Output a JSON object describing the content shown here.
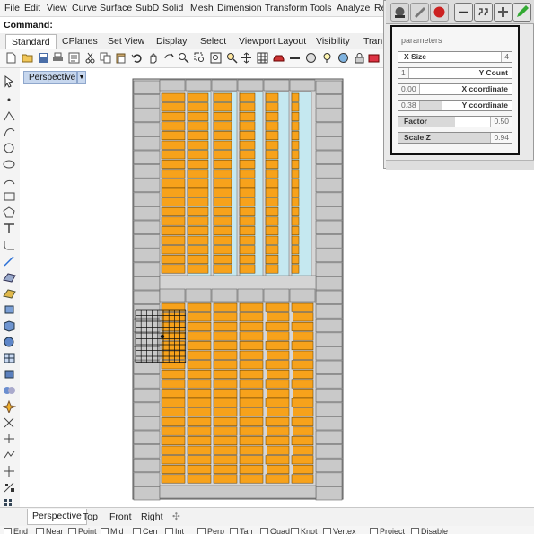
{
  "menu": [
    "File",
    "Edit",
    "View",
    "Curve",
    "Surface",
    "SubD",
    "Solid",
    "Mesh",
    "Dimension",
    "Transform",
    "Tools",
    "Analyze",
    "Re"
  ],
  "command": {
    "label": "Command:"
  },
  "toolbar_tabs": [
    "Standard",
    "CPlanes",
    "Set View",
    "Display",
    "Select",
    "Viewport Layout",
    "Visibility",
    "Tran"
  ],
  "viewport": {
    "title": "Perspective",
    "dropdown_icon": "chevron-down-icon"
  },
  "bottom_tabs": [
    "Perspective",
    "Top",
    "Front",
    "Right"
  ],
  "bottom_add_icon": "plus-icon",
  "osnaps": [
    "End",
    "Near",
    "Point",
    "Mid",
    "Cen",
    "Int",
    "Perp",
    "Tan",
    "Quad",
    "Knot",
    "Vertex",
    "Project",
    "Disable"
  ],
  "gh_panel": {
    "title": "parameters",
    "params": [
      {
        "label": "X Size",
        "value": "4",
        "fill": 0.0
      },
      {
        "label": "Y Count",
        "value": "1",
        "fill": 0.0
      },
      {
        "label": "X coordinate",
        "value": "0.00",
        "fill": 0.0
      },
      {
        "label": "Y coordinate",
        "value": "0.38",
        "fill": 0.38
      },
      {
        "label": "Factor",
        "value": "0.50",
        "fill": 0.5
      },
      {
        "label": "Scale Z",
        "value": "0.94",
        "fill": 0.94
      }
    ]
  },
  "colors": {
    "accent_orange": "#f7a21b",
    "panel_gray": "#c9c9c9",
    "glass_blue": "#c5e8f0",
    "viewport_tab": "#c7d7ee"
  }
}
